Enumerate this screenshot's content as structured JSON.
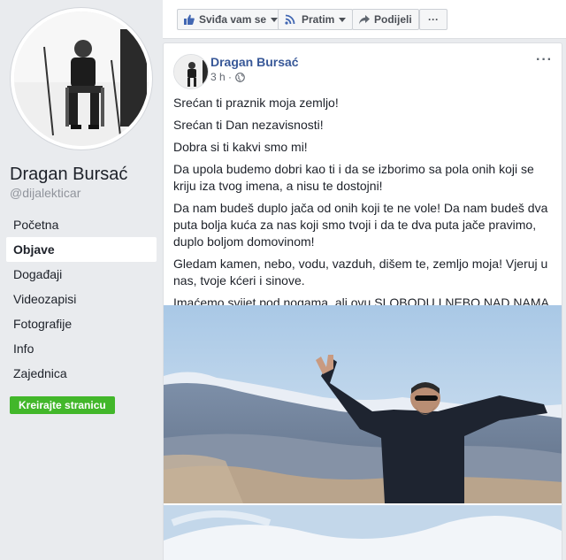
{
  "sidebar": {
    "page_name": "Dragan Bursać",
    "handle": "@dijalekticar",
    "items": [
      {
        "label": "Početna"
      },
      {
        "label": "Objave"
      },
      {
        "label": "Događaji"
      },
      {
        "label": "Videozapisi"
      },
      {
        "label": "Fotografije"
      },
      {
        "label": "Info"
      },
      {
        "label": "Zajednica"
      }
    ],
    "create_button": "Kreirajte stranicu"
  },
  "actionbar": {
    "like": "Sviđa vam se",
    "follow": "Pratim",
    "share": "Podijeli",
    "more": "···"
  },
  "post": {
    "author": "Dragan Bursać",
    "time": "3 h ·",
    "more": "···",
    "paragraphs": [
      "Srećan ti praznik moja zemljo!",
      "Srećan ti Dan nezavisnosti!",
      "Dobra si ti kakvi smo mi!",
      "Da upola budemo dobri kao ti i da se izborimo sa pola onih koji se kriju iza tvog imena, a nisu te dostojni!",
      "Da nam budeš duplo jača od onih koji te ne vole! Da nam budeš dva puta bolja kuća za nas koji smo tvoji i da te dva puta jače pravimo, duplo boljom domovinom!",
      "Gledam kamen, nebo, vodu, vazduh, dišem te, zemljo moja! Vjeruj u nas, tvoje kćeri i sinove.",
      "Imaćemo svijet pod nogama, ali ovu SLOBODU I NEBO NAD NAMA, samo nam ti daješ Bosno i Hercegovino!"
    ]
  },
  "colors": {
    "link_blue": "#385898",
    "green": "#42b72a",
    "background": "#e9ebee"
  }
}
